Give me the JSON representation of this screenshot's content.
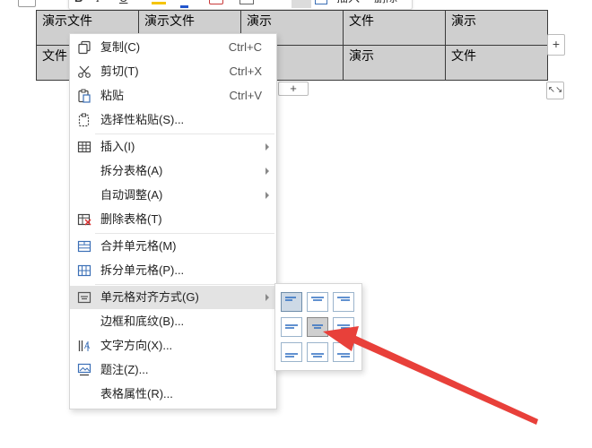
{
  "toolbar": {
    "bold": "B",
    "italic": "I",
    "underline": "U",
    "font_color": "A",
    "insert_label": "插入",
    "delete_label": "删除"
  },
  "table": {
    "rows": [
      [
        "演示文件",
        "演示文件",
        "演示",
        "文件",
        "演示"
      ],
      [
        "文件",
        "",
        "",
        "演示",
        "文件"
      ]
    ],
    "add_column": "+",
    "add_row": "+",
    "resize": "↖↘"
  },
  "context_menu": {
    "items": [
      {
        "icon": "copy-icon",
        "label": "复制(C)",
        "shortcut": "Ctrl+C"
      },
      {
        "icon": "cut-icon",
        "label": "剪切(T)",
        "shortcut": "Ctrl+X"
      },
      {
        "icon": "paste-icon",
        "label": "粘贴",
        "shortcut": "Ctrl+V"
      },
      {
        "icon": "paste-special-icon",
        "label": "选择性粘贴(S)..."
      },
      {
        "icon": "table-insert-icon",
        "label": "插入(I)"
      },
      {
        "label": "拆分表格(A)"
      },
      {
        "label": "自动调整(A)"
      },
      {
        "icon": "delete-table-icon",
        "label": "删除表格(T)"
      },
      {
        "icon": "merge-cells-icon",
        "label": "合并单元格(M)"
      },
      {
        "icon": "split-cells-icon",
        "label": "拆分单元格(P)..."
      },
      {
        "icon": "cell-align-icon",
        "label": "单元格对齐方式(G)"
      },
      {
        "label": "边框和底纹(B)..."
      },
      {
        "icon": "text-direction-icon",
        "label": "文字方向(X)..."
      },
      {
        "icon": "caption-icon",
        "label": "题注(Z)..."
      },
      {
        "label": "表格属性(R)..."
      }
    ]
  },
  "colors": {
    "table_fill": "#cfcfcf",
    "menu_hover": "#e3e3e3",
    "align_selected": "#cdd9e6",
    "annotation_arrow": "#e8403a"
  }
}
